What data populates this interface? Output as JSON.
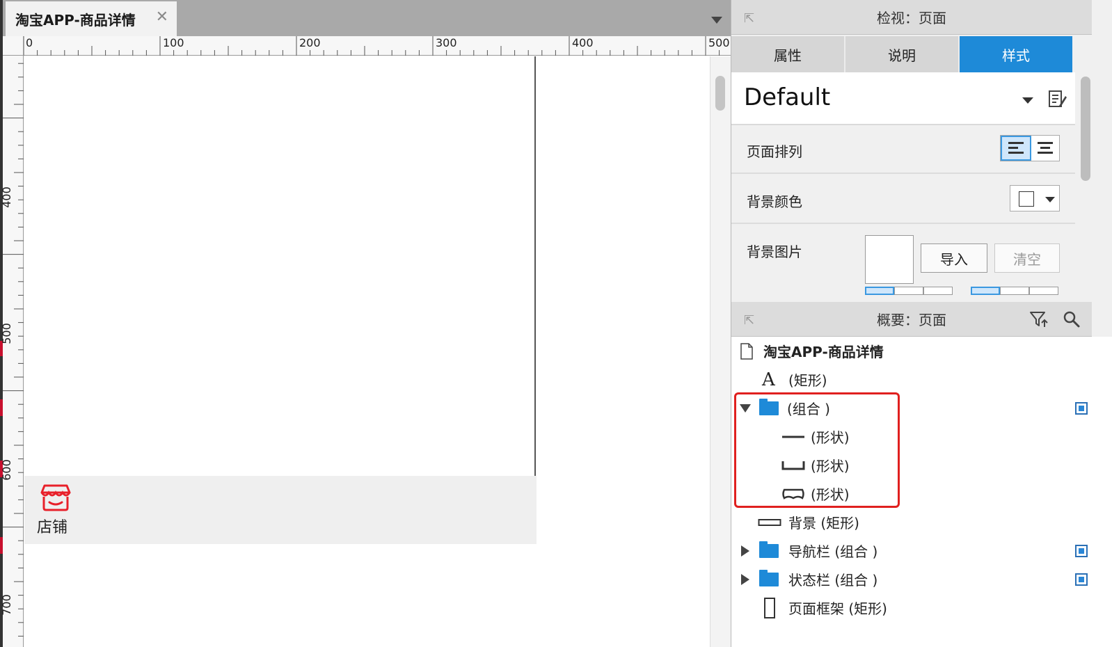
{
  "document_tab": {
    "title": "淘宝APP-商品详情",
    "close_glyph": "✕"
  },
  "ruler": {
    "horizontal_labels": [
      "0",
      "100",
      "200",
      "300",
      "400",
      "500"
    ],
    "vertical_labels": [
      "400",
      "500",
      "600",
      "700"
    ]
  },
  "canvas": {
    "shop_label": "店铺",
    "shop_icon": "store-icon"
  },
  "inspector": {
    "title": "检视：页面",
    "tabs": [
      {
        "label": "属性",
        "active": false
      },
      {
        "label": "说明",
        "active": false
      },
      {
        "label": "样式",
        "active": true
      }
    ],
    "style_name": "Default",
    "page_align_label": "页面排列",
    "bg_color_label": "背景颜色",
    "bg_image_label": "背景图片",
    "import_label": "导入",
    "clear_label": "清空"
  },
  "outline": {
    "title": "概要：页面",
    "page_name": "淘宝APP-商品详情",
    "items": [
      {
        "label": "(矩形)",
        "icon": "text-icon"
      },
      {
        "label": "(组合 )",
        "icon": "folder-icon"
      },
      {
        "label": "(形状)",
        "icon": "line-shape-icon"
      },
      {
        "label": "(形状)",
        "icon": "bracket-shape-icon"
      },
      {
        "label": "(形状)",
        "icon": "rounded-shape-icon"
      },
      {
        "label": "背景 (矩形)",
        "icon": "rectangle-icon"
      },
      {
        "label": "导航栏 (组合 )",
        "icon": "folder-icon"
      },
      {
        "label": "状态栏 (组合 )",
        "icon": "folder-icon"
      },
      {
        "label": "页面框架 (矩形)",
        "icon": "rectangle-icon"
      }
    ]
  },
  "colors": {
    "accent": "#1e8ad8",
    "highlight": "#e0201f",
    "shop_icon": "#e8202a"
  }
}
